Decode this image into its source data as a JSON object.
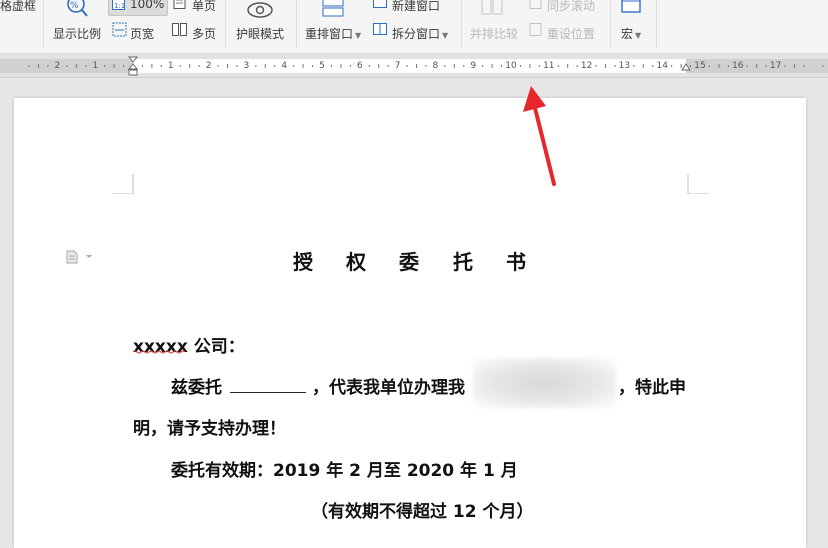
{
  "toolbar": {
    "partial_label": "格虚框",
    "display_ratio": "显示比例",
    "zoom_value": "100%",
    "single_page": "单页",
    "page_width": "页宽",
    "multi_page": "多页",
    "eye_care": "护眼模式",
    "rearrange_window": "重排窗口",
    "new_window": "新建窗口",
    "split_window": "拆分窗口",
    "side_by_side": "并排比较",
    "sync_scroll": "同步滚动",
    "reset_position": "重设位置",
    "macro": "宏"
  },
  "ruler": {
    "ticks": [
      "2",
      "1",
      "1",
      "2",
      "3",
      "4",
      "5",
      "6",
      "7",
      "8",
      "9",
      "10",
      "11",
      "12",
      "13",
      "14",
      "15",
      "16",
      "17"
    ]
  },
  "document": {
    "title_chars": [
      "授",
      "权",
      "委",
      "托",
      "书"
    ],
    "salutation_name": "xxxxx",
    "salutation_rest": " 公司：",
    "line1_a": "兹委托",
    "line1_b": "，代表我单位办理我",
    "line1_c": "，特此申",
    "line2": "明，请予支持办理！",
    "line3": "委托有效期：2019 年 2 月至 2020 年 1 月",
    "line4": "（有效期不得超过 12 个月）"
  },
  "annotation": {
    "arrow_color": "#e8262b"
  }
}
